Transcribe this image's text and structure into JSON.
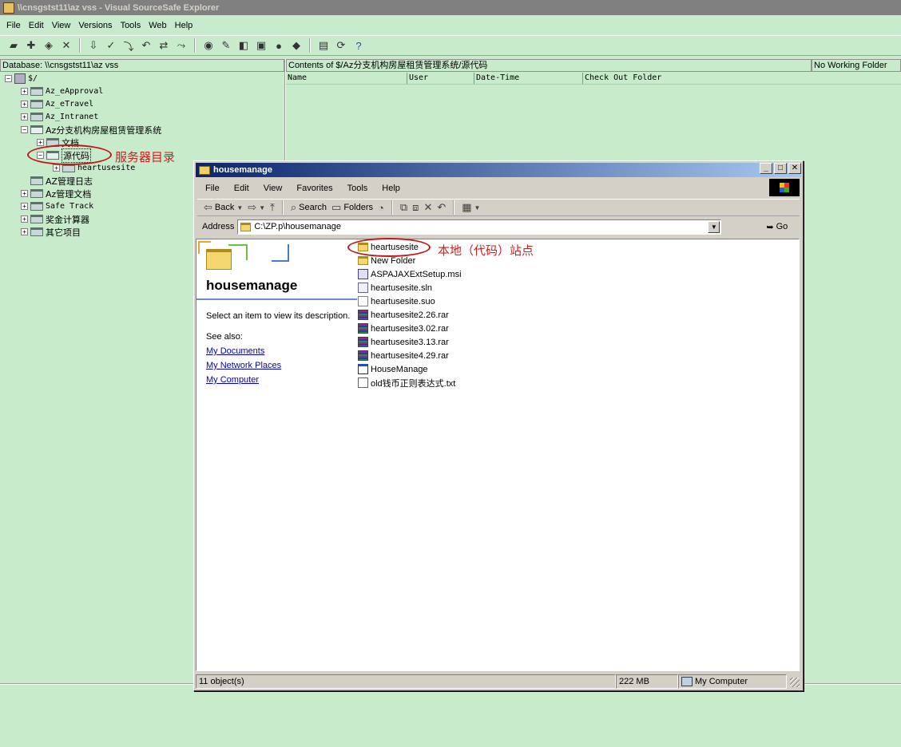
{
  "vss": {
    "title": "\\\\cnsgstst11\\az vss - Visual SourceSafe Explorer",
    "menu": [
      "File",
      "Edit",
      "View",
      "Versions",
      "Tools",
      "Web",
      "Help"
    ],
    "database_label": "Database: \\\\cnsgstst11\\az vss",
    "contents_label": "Contents of $/Az分支机构房屋租赁管理系统/源代码",
    "working_folder": "No Working Folder",
    "columns": [
      "Name",
      "User",
      "Date-Time",
      "Check Out Folder"
    ],
    "tree": {
      "root": "$/",
      "items": [
        {
          "label": "Az_eApproval",
          "state": "collapsed"
        },
        {
          "label": "Az_eTravel",
          "state": "collapsed"
        },
        {
          "label": "Az_Intranet",
          "state": "collapsed"
        },
        {
          "label": "Az分支机构房屋租赁管理系统",
          "state": "expanded"
        },
        {
          "label": "文档",
          "state": "collapsed"
        },
        {
          "label": "源代码",
          "state": "expanded"
        },
        {
          "label": "heartusesite",
          "state": "collapsed"
        },
        {
          "label": "AZ管理日志",
          "state": "leaf"
        },
        {
          "label": "Az管理文档",
          "state": "collapsed"
        },
        {
          "label": "Safe Track",
          "state": "collapsed"
        },
        {
          "label": "奖金计算器",
          "state": "collapsed"
        },
        {
          "label": "其它项目",
          "state": "collapsed"
        }
      ]
    },
    "annotation_server": "服务器目录"
  },
  "explorer": {
    "title": "housemanage",
    "menu": [
      "File",
      "Edit",
      "View",
      "Favorites",
      "Tools",
      "Help"
    ],
    "toolbar": {
      "back": "Back",
      "search": "Search",
      "folders": "Folders"
    },
    "address_label": "Address",
    "address_value": "C:\\ZP.p\\housemanage",
    "go_label": "Go",
    "left_pane": {
      "folder_name": "housemanage",
      "description": "Select an item to view its description.",
      "see_also": "See also:",
      "links": [
        "My Documents",
        "My Network Places",
        "My Computer"
      ]
    },
    "files": [
      {
        "name": "heartusesite",
        "icon": "folder"
      },
      {
        "name": "New Folder",
        "icon": "folder"
      },
      {
        "name": "ASPAJAXExtSetup.msi",
        "icon": "msi"
      },
      {
        "name": "heartusesite.sln",
        "icon": "sln"
      },
      {
        "name": "heartusesite.suo",
        "icon": "suo"
      },
      {
        "name": "heartusesite2.26.rar",
        "icon": "rar"
      },
      {
        "name": "heartusesite3.02.rar",
        "icon": "rar"
      },
      {
        "name": "heartusesite3.13.rar",
        "icon": "rar"
      },
      {
        "name": "heartusesite4.29.rar",
        "icon": "rar"
      },
      {
        "name": "HouseManage",
        "icon": "exe"
      },
      {
        "name": "old钱币正则表达式.txt",
        "icon": "txt"
      }
    ],
    "annotation_local": "本地（代码）站点",
    "status": {
      "objects": "11 object(s)",
      "size": "222 MB",
      "location": "My Computer"
    }
  }
}
